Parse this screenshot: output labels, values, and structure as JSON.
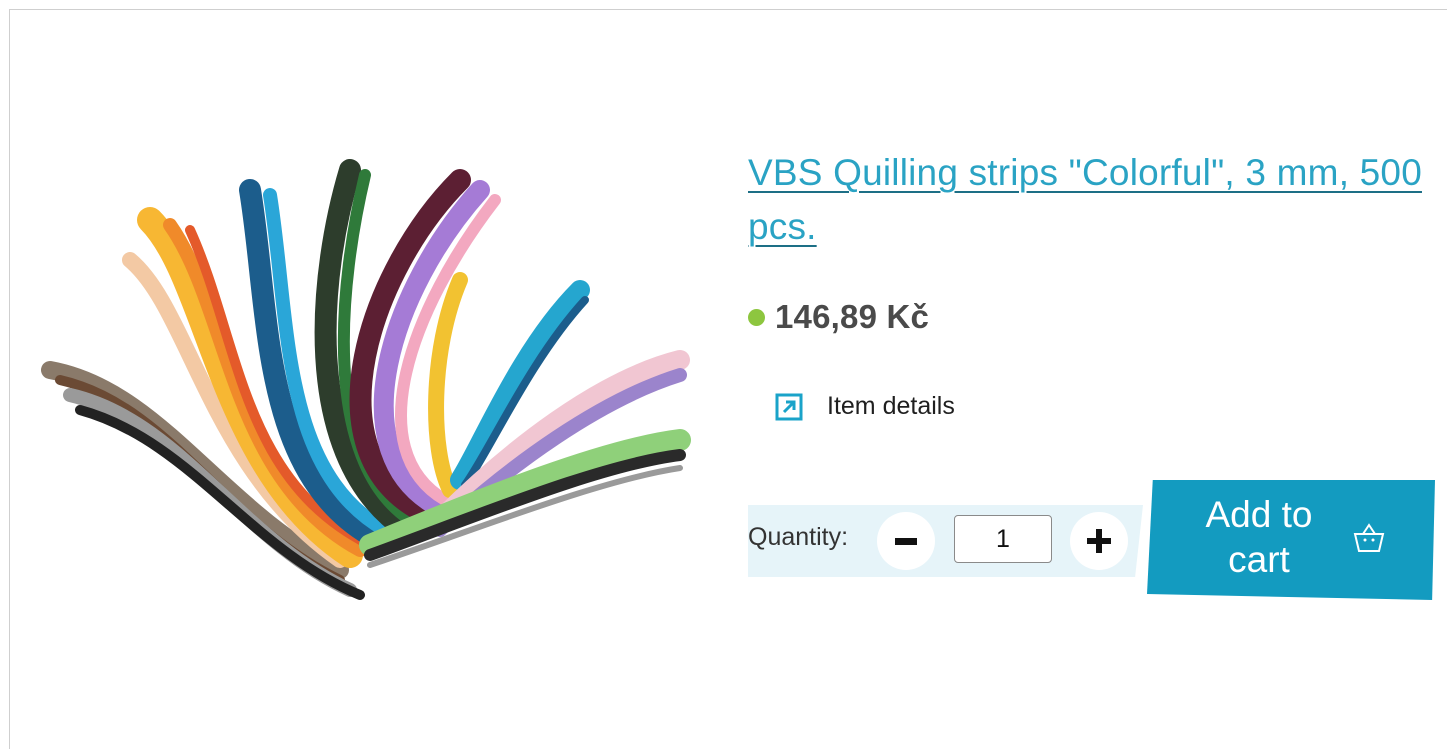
{
  "product": {
    "title": "VBS Quilling strips \"Colorful\", 3 mm, 500 pcs.",
    "price": "146,89 Kč",
    "details_label": "Item details",
    "image_alt": "colorful quilling paper strips fanned out",
    "availability_color": "#8dc63f"
  },
  "quantity": {
    "label": "Quantity:",
    "value": "1",
    "decrease_icon": "minus-icon",
    "increase_icon": "plus-icon"
  },
  "cart": {
    "label": "Add to cart",
    "icon": "basket-icon"
  },
  "colors": {
    "accent": "#139bc0",
    "link": "#2aa3c4",
    "band": "#e6f4f9"
  }
}
